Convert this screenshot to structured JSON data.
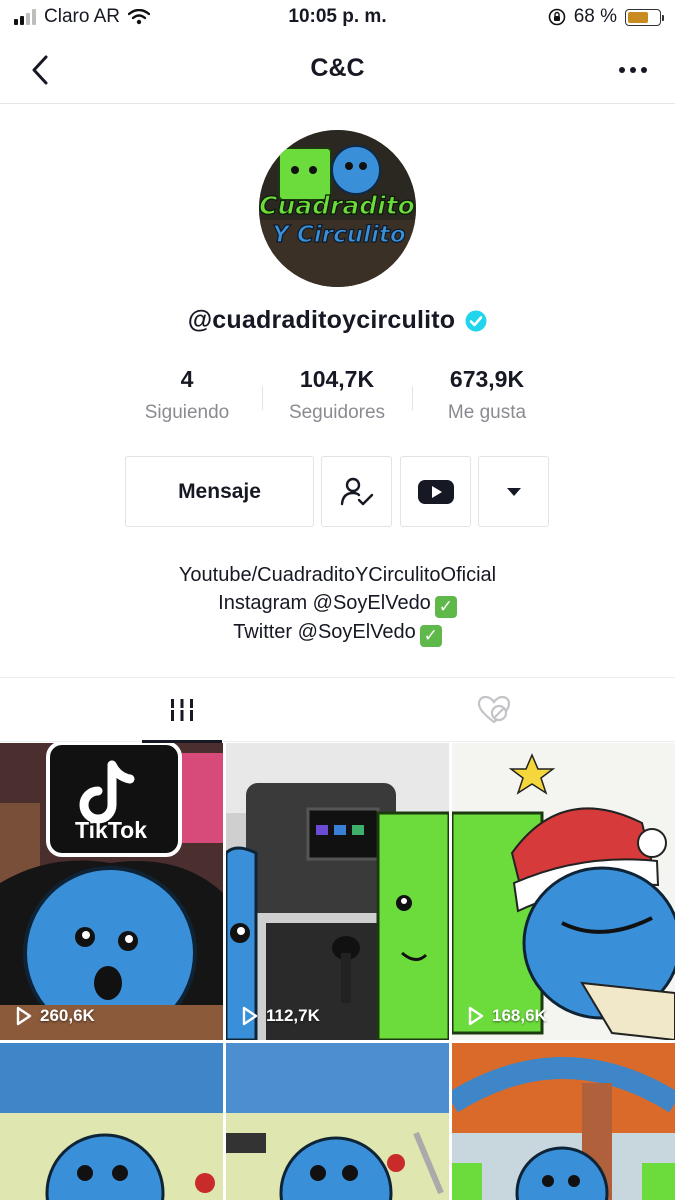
{
  "status_bar": {
    "carrier": "Claro AR",
    "time": "10:05 p. m.",
    "battery_percent": "68 %",
    "battery_level": 0.68
  },
  "nav": {
    "title": "C&C"
  },
  "profile": {
    "avatar_text_line1": "Cuadradito",
    "avatar_text_line2": "Y Circulito",
    "username": "@cuadraditoycirculito",
    "verified": true
  },
  "stats": [
    {
      "value": "4",
      "label": "Siguiendo"
    },
    {
      "value": "104,7K",
      "label": "Seguidores"
    },
    {
      "value": "673,9K",
      "label": "Me gusta"
    }
  ],
  "buttons": {
    "message_label": "Mensaje"
  },
  "bio": {
    "line1": "Youtube/CuadraditoYCirculitoOficial",
    "line2": "Instagram @SoyElVedo",
    "line3": "Twitter @SoyElVedo",
    "check_glyph": "✓"
  },
  "tabs": {
    "videos_icon": "grid-videos-icon",
    "liked_icon": "liked-hidden-icon"
  },
  "videos": [
    {
      "views": "260,6K",
      "tiktok_logo_text": "TikTok"
    },
    {
      "views": "112,7K"
    },
    {
      "views": "168,6K"
    },
    {
      "views": ""
    },
    {
      "views": ""
    },
    {
      "views": ""
    }
  ],
  "colors": {
    "verified_blue": "#20d5ec",
    "battery": "#c98a1f",
    "check_green": "#5fb94a",
    "character_blue": "#3a8fd9",
    "character_green": "#6cdc3c"
  }
}
